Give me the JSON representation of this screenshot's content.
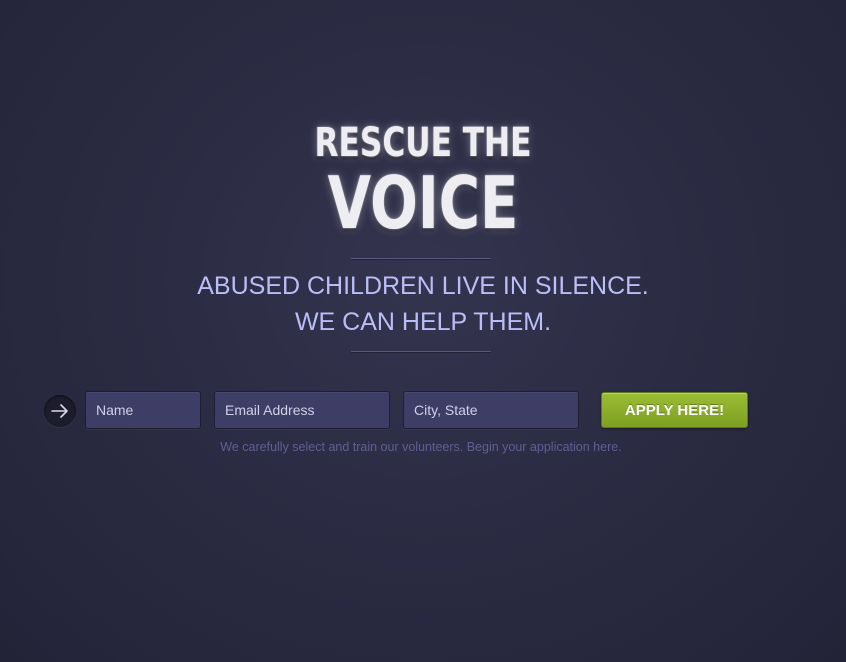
{
  "logo": {
    "line1": "RESCUE THE",
    "line2": "VOICE"
  },
  "tagline": {
    "line1": "ABUSED CHILDREN LIVE IN SILENCE.",
    "line2": "WE CAN HELP THEM."
  },
  "form": {
    "arrow_icon": "arrow-right-icon",
    "name_placeholder": "Name",
    "email_placeholder": "Email Address",
    "city_placeholder": "City, State",
    "submit_label": "APPLY HERE!",
    "note": "We carefully select and train our volunteers. Begin your application here."
  },
  "colors": {
    "background": "#2b2b43",
    "tagline": "#bcbcf7",
    "field_bg": "#3e3d66",
    "accent_green": "#8db02b",
    "note_text": "#5f5f94"
  }
}
